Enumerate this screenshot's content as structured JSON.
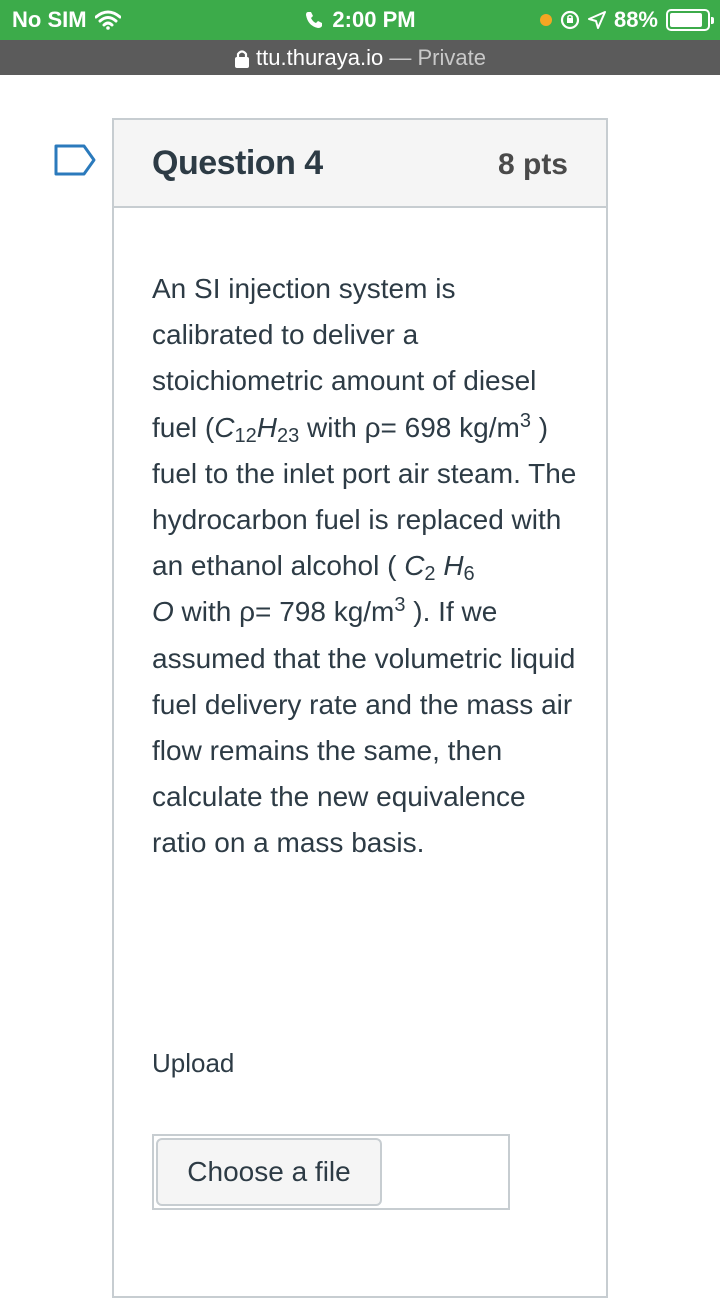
{
  "status_bar": {
    "carrier": "No SIM",
    "time": "2:00 PM",
    "battery": "88%",
    "battery_level": 0.88,
    "color": "#3cab4a"
  },
  "url_bar": {
    "domain": "ttu.thuraya.io",
    "separator": " — ",
    "mode": "Private"
  },
  "question": {
    "title": "Question 4",
    "points": "8 pts",
    "body": {
      "t1": "An SI injection system is calibrated to deliver a stoichiometric amount of diesel fuel (",
      "c1": "C",
      "c1_sub": "12",
      "h1": "H",
      "h1_sub": "23",
      "t2": "  with  ρ= 698 kg/m",
      "sup1": "3",
      "t3": " ) fuel to the inlet port air steam. The hydrocarbon fuel is replaced with an ethanol alcohol ( ",
      "c2": "C",
      "c2_sub": "2",
      "h2": " H",
      "h2_sub": "6",
      "o2": " O",
      "t4": " with  ρ= 798 kg/m",
      "sup2": "3",
      "t5": " ). If we assumed that the volumetric liquid fuel delivery rate and the mass air flow remains the same, then calculate the new equivalence ratio on a mass basis."
    },
    "upload_label": "Upload",
    "choose_file_label": "Choose a file"
  }
}
